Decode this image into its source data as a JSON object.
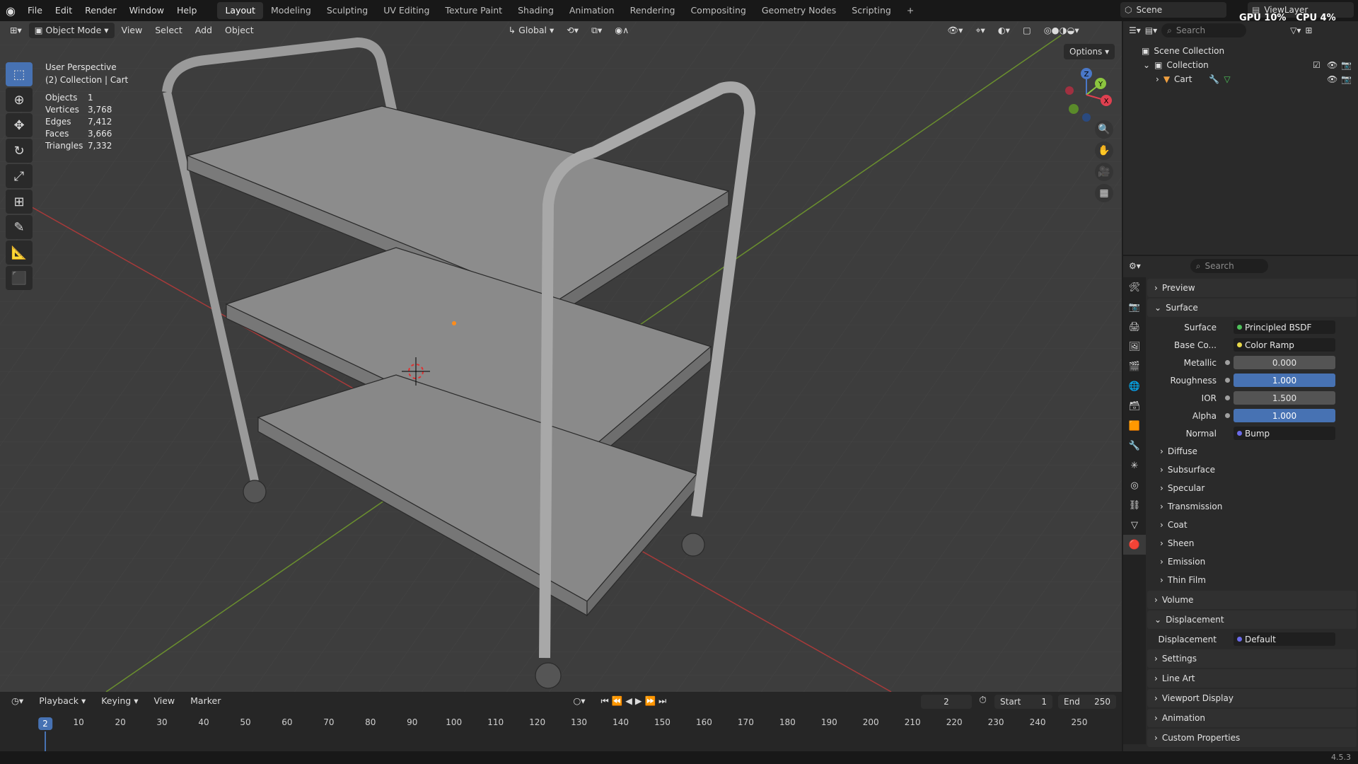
{
  "topbar": {
    "menus": [
      "File",
      "Edit",
      "Render",
      "Window",
      "Help"
    ],
    "workspaces": [
      "Layout",
      "Modeling",
      "Sculpting",
      "UV Editing",
      "Texture Paint",
      "Shading",
      "Animation",
      "Rendering",
      "Compositing",
      "Geometry Nodes",
      "Scripting"
    ],
    "active_workspace": "Layout",
    "scene": "Scene",
    "view_layer": "ViewLayer",
    "gpu": "GPU 10%",
    "cpu": "CPU 4%"
  },
  "viewport": {
    "mode": "Object Mode",
    "menus": [
      "View",
      "Select",
      "Add",
      "Object"
    ],
    "transform": "Global",
    "options": "Options",
    "perspective": "User Perspective",
    "collection_info": "(2) Collection | Cart",
    "stats": [
      {
        "k": "Objects",
        "v": "1"
      },
      {
        "k": "Vertices",
        "v": "3,768"
      },
      {
        "k": "Edges",
        "v": "7,412"
      },
      {
        "k": "Faces",
        "v": "3,666"
      },
      {
        "k": "Triangles",
        "v": "7,332"
      }
    ],
    "gizmo": {
      "z": "Z",
      "y": "Y",
      "x": "X"
    }
  },
  "timeline": {
    "menus": [
      "Playback",
      "Keying",
      "View",
      "Marker"
    ],
    "current_frame": "2",
    "start_label": "Start",
    "start": "1",
    "end_label": "End",
    "end": "250",
    "ticks": [
      "2",
      "10",
      "20",
      "30",
      "40",
      "50",
      "60",
      "70",
      "80",
      "90",
      "100",
      "110",
      "120",
      "130",
      "140",
      "150",
      "160",
      "170",
      "180",
      "190",
      "200",
      "210",
      "220",
      "230",
      "240",
      "250"
    ]
  },
  "outliner": {
    "search_placeholder": "Search",
    "scene_collection": "Scene Collection",
    "collection": "Collection",
    "object": "Cart"
  },
  "properties": {
    "search_placeholder": "Search",
    "sections": {
      "preview": "Preview",
      "surface": "Surface",
      "volume": "Volume",
      "displacement": "Displacement",
      "settings": "Settings",
      "line_art": "Line Art",
      "viewport_display": "Viewport Display",
      "animation": "Animation",
      "custom_properties": "Custom Properties"
    },
    "surface_rows": [
      {
        "label": "Surface",
        "value": "Principled BSDF",
        "kind": "link",
        "color": "#4ec05a"
      },
      {
        "label": "Base Co...",
        "value": "Color Ramp",
        "kind": "link",
        "color": "#e8d84a"
      },
      {
        "label": "Metallic",
        "value": "0.000",
        "kind": "num",
        "color": "#a0a0a0"
      },
      {
        "label": "Roughness",
        "value": "1.000",
        "kind": "blue",
        "color": "#a0a0a0"
      },
      {
        "label": "IOR",
        "value": "1.500",
        "kind": "num",
        "color": "#a0a0a0"
      },
      {
        "label": "Alpha",
        "value": "1.000",
        "kind": "blue",
        "color": "#a0a0a0"
      },
      {
        "label": "Normal",
        "value": "Bump",
        "kind": "link",
        "color": "#6a6ae8"
      }
    ],
    "subpanels": [
      "Diffuse",
      "Subsurface",
      "Specular",
      "Transmission",
      "Coat",
      "Sheen",
      "Emission",
      "Thin Film"
    ],
    "displacement_row": {
      "label": "Displacement",
      "value": "Default",
      "color": "#6a6ae8"
    }
  },
  "status": {
    "version": "4.5.3"
  }
}
